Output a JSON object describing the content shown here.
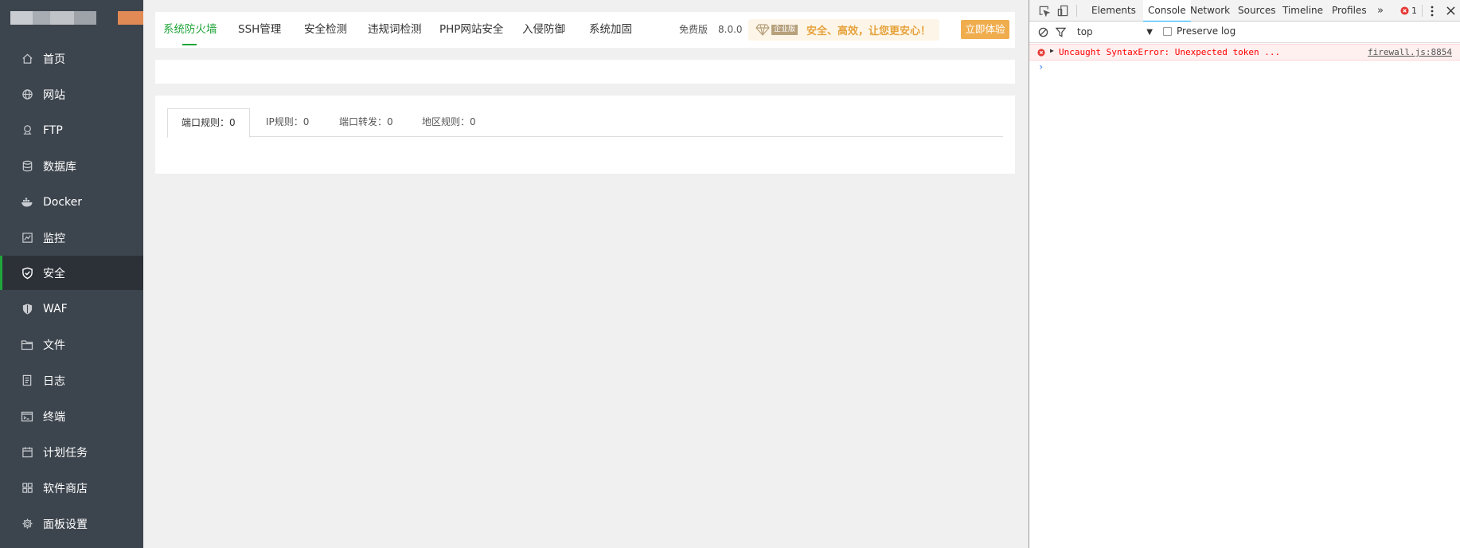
{
  "sidebar": {
    "items": [
      {
        "label": "首页",
        "icon": "home-icon"
      },
      {
        "label": "网站",
        "icon": "globe-icon"
      },
      {
        "label": "FTP",
        "icon": "ftp-icon"
      },
      {
        "label": "数据库",
        "icon": "database-icon"
      },
      {
        "label": "Docker",
        "icon": "docker-icon"
      },
      {
        "label": "监控",
        "icon": "monitor-icon"
      },
      {
        "label": "安全",
        "icon": "shield-icon",
        "active": true
      },
      {
        "label": "WAF",
        "icon": "waf-shield-icon"
      },
      {
        "label": "文件",
        "icon": "folder-icon"
      },
      {
        "label": "日志",
        "icon": "log-icon"
      },
      {
        "label": "终端",
        "icon": "terminal-icon"
      },
      {
        "label": "计划任务",
        "icon": "calendar-icon"
      },
      {
        "label": "软件商店",
        "icon": "apps-icon"
      },
      {
        "label": "面板设置",
        "icon": "gear-icon"
      }
    ],
    "active_color": "#20a53a"
  },
  "topbar": {
    "tabs": [
      "系统防火墙",
      "SSH管理",
      "安全检测",
      "违规词检测",
      "PHP网站安全",
      "入侵防御",
      "系统加固"
    ],
    "edition": "免费版",
    "version": "8.0.0",
    "promo_badge": "企业版",
    "promo_text": "安全、高效，让您更安心！",
    "try_button": "立即体验"
  },
  "firewall": {
    "subtabs": [
      "端口规则：0",
      "IP规则：0",
      "端口转发：0",
      "地区规则：0"
    ]
  },
  "devtools": {
    "tabs": [
      "Elements",
      "Console",
      "Network",
      "Sources",
      "Timeline",
      "Profiles"
    ],
    "active_tab": "Console",
    "error_count": "1",
    "context": "top",
    "preserve_log": "Preserve log",
    "error_message": "Uncaught SyntaxError: Unexpected token ...",
    "error_source": "firewall.js:8854",
    "prompt": "›"
  }
}
